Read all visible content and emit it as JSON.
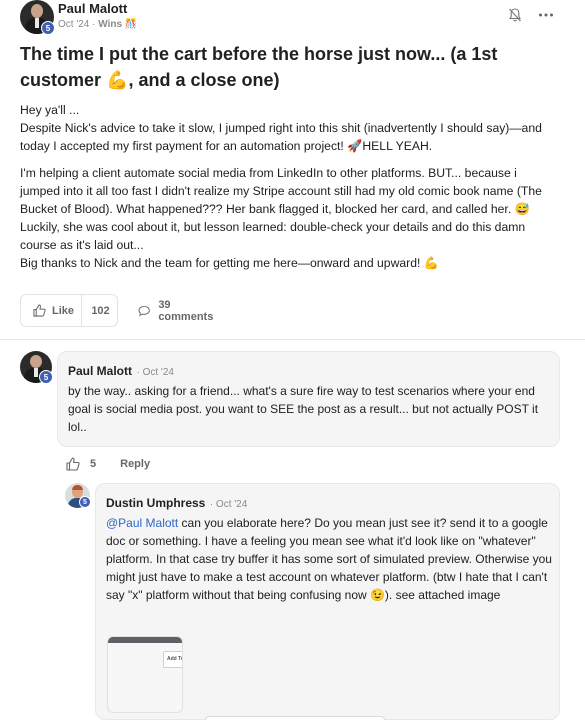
{
  "post": {
    "author": "Paul Malott",
    "level": "5",
    "date": "Oct '24",
    "dot": "·",
    "category": "Wins",
    "category_emoji": "🎊",
    "title": "The time I put the cart before the horse just now... (a 1st customer 💪, and a close one)",
    "paragraphs": [
      "Hey ya'll ...\nDespite Nick's advice to take it slow, I jumped right into this shit (inadvertently I should say)—and today I accepted my first payment for an automation project! 🚀HELL YEAH.",
      "I'm helping a client automate social media from LinkedIn to other platforms. BUT... because i jumped into it all too fast I didn't realize my Stripe account still had my old comic book name (The Bucket of Blood). What happened??? Her bank flagged it, blocked her card, and called her. 😅\nLuckily, she was cool about it, but lesson learned: double-check your details and do this damn course as it's laid out...\nBig thanks to Nick and the team for getting me here—onward and upward! 💪"
    ],
    "like_label": "Like",
    "like_count": "102",
    "comments_label": "39 comments"
  },
  "comments": [
    {
      "author": "Paul Malott",
      "level": "5",
      "date": "· Oct '24",
      "text": "by the way.. asking for a friend... what's a sure fire way to test scenarios where your end goal is social media post. you want to SEE the post as a result... but not actually POST it lol..",
      "like_count": "5",
      "reply_label": "Reply"
    },
    {
      "author": "Dustin Umphress",
      "level": "5",
      "date": "· Oct '24",
      "mention": "@Paul Malott",
      "text": " can you elaborate here? Do you mean just see it? send it to a google doc or something. I have a feeling you mean see what it'd look like on \"whatever\" platform. In that case try buffer it has some sort of simulated preview. Otherwise you might just have to make a test account on whatever platform. (btw I hate that I can't say \"x\" platform without that being confusing now 😉). see attached image",
      "image_button_text": "Add To"
    }
  ],
  "icons": {
    "bell": "bell-off-icon",
    "more": "more-horizontal-icon",
    "like": "thumbs-up-icon",
    "comment": "comment-bubble-icon"
  },
  "colors": {
    "badge": "#3f5fb4",
    "mention": "#2e67c6",
    "bubble": "#f5f5f5"
  }
}
